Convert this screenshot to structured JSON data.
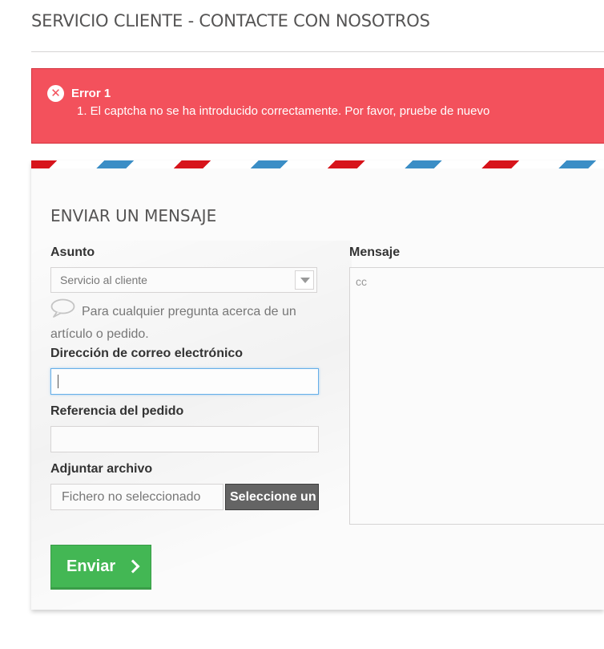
{
  "page": {
    "heading": "SERVICIO CLIENTE - CONTACTE CON NOSOTROS"
  },
  "alert": {
    "icon": "close-circle-icon",
    "title": "Error 1",
    "message": "1. El captcha no se ha introducido correctamente. Por favor, pruebe de nuevo",
    "color": "#f3515c"
  },
  "form": {
    "title": "ENVIAR UN MENSAJE",
    "subject": {
      "label": "Asunto",
      "selected": "Servicio al cliente",
      "hint": "Para cualquier pregunta acerca de un artículo o pedido."
    },
    "email": {
      "label": "Dirección de correo electrónico",
      "value": ""
    },
    "order_ref": {
      "label": "Referencia del pedido",
      "value": ""
    },
    "attachment": {
      "label": "Adjuntar archivo",
      "filename": "Fichero no seleccionado",
      "button": "Seleccione un"
    },
    "message": {
      "label": "Mensaje",
      "value": "cc"
    },
    "submit": {
      "label": "Enviar",
      "icon": "chevron-right-icon",
      "color": "#43b754"
    }
  },
  "colors": {
    "stripe_blue": "#3b8ec6",
    "stripe_red": "#d7141b"
  }
}
